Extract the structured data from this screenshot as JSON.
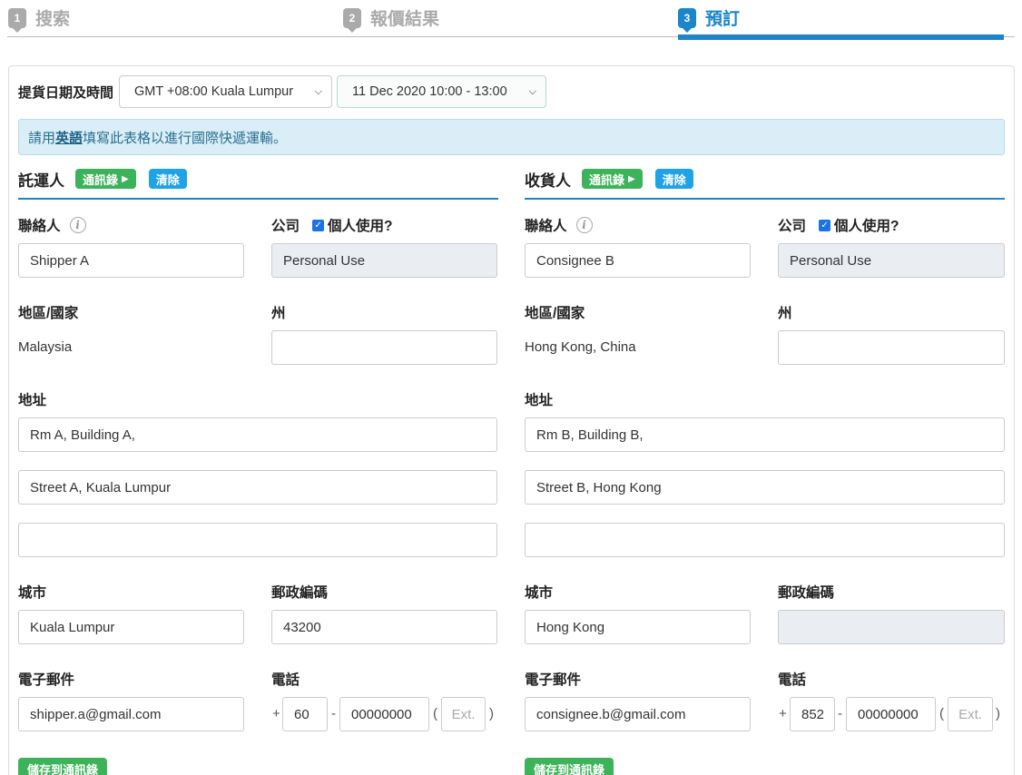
{
  "steps": [
    {
      "num": "1",
      "label": "搜索"
    },
    {
      "num": "2",
      "label": "報價結果"
    },
    {
      "num": "3",
      "label": "預訂"
    }
  ],
  "pickup": {
    "label": "提貨日期及時間",
    "timezone": "GMT +08:00 Kuala Lumpur",
    "date": "11 Dec 2020 10:00 - 13:00"
  },
  "alert": {
    "before": "請用",
    "bold": "英語",
    "after": "填寫此表格以進行國際快遞運輸。"
  },
  "shipper": {
    "title": "託運人",
    "addressbook_btn": "通訊錄",
    "clear_btn": "清除",
    "contact_label": "聯絡人",
    "contact_value": "Shipper A",
    "company_label": "公司",
    "personal_label": "個人使用?",
    "company_value": "Personal Use",
    "country_label": "地區/國家",
    "country_value": "Malaysia",
    "state_label": "州",
    "state_value": "",
    "address_label": "地址",
    "address1": "Rm A, Building A,",
    "address2": "Street A, Kuala Lumpur",
    "address3": "",
    "city_label": "城市",
    "city_value": "Kuala Lumpur",
    "postal_label": "郵政編碼",
    "postal_value": "43200",
    "email_label": "電子郵件",
    "email_value": "shipper.a@gmail.com",
    "phone_label": "電話",
    "phone_code": "60",
    "phone_number": "00000000",
    "phone_ext_placeholder": "Ext.",
    "save_btn": "儲存到通訊錄"
  },
  "consignee": {
    "title": "收貨人",
    "addressbook_btn": "通訊錄",
    "clear_btn": "清除",
    "contact_label": "聯絡人",
    "contact_value": "Consignee B",
    "company_label": "公司",
    "personal_label": "個人使用?",
    "company_value": "Personal Use",
    "country_label": "地區/國家",
    "country_value": "Hong Kong, China",
    "state_label": "州",
    "state_value": "",
    "address_label": "地址",
    "address1": "Rm B, Building B,",
    "address2": "Street B, Hong Kong",
    "address3": "",
    "city_label": "城市",
    "city_value": "Hong Kong",
    "postal_label": "郵政編碼",
    "postal_value": "",
    "email_label": "電子郵件",
    "email_value": "consignee.b@gmail.com",
    "phone_label": "電話",
    "phone_code": "852",
    "phone_number": "00000000",
    "phone_ext_placeholder": "Ext.",
    "save_btn": "儲存到通訊錄"
  },
  "colors": {
    "accent": "#1a85c8",
    "green": "#3cb35a",
    "light_blue": "#1fa2e6",
    "alert_bg": "#d9eef7"
  }
}
